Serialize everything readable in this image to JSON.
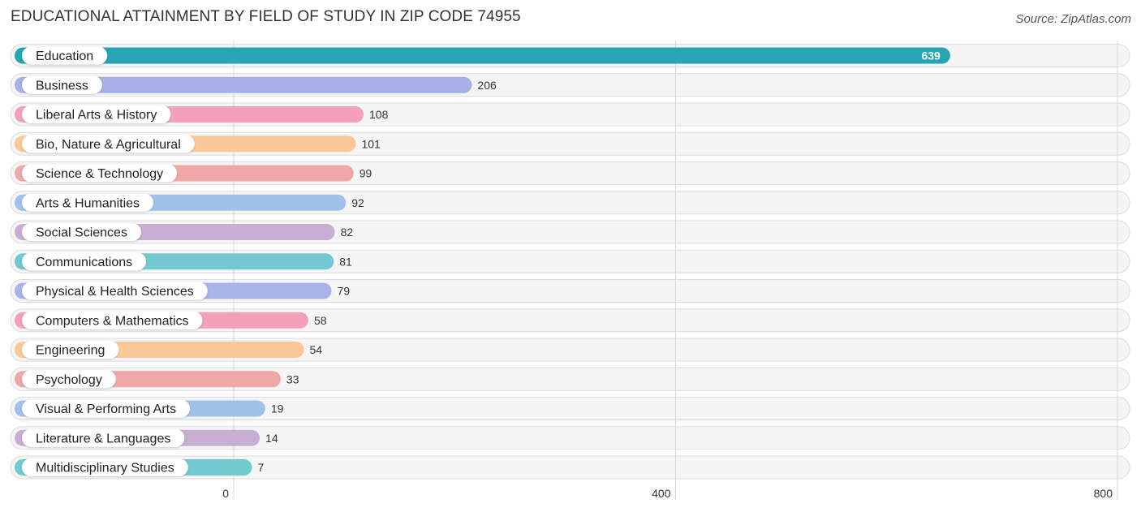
{
  "header": {
    "title": "EDUCATIONAL ATTAINMENT BY FIELD OF STUDY IN ZIP CODE 74955",
    "source": "Source: ZipAtlas.com"
  },
  "chart_data": {
    "type": "bar",
    "orientation": "horizontal",
    "title": "EDUCATIONAL ATTAINMENT BY FIELD OF STUDY IN ZIP CODE 74955",
    "xlabel": "",
    "ylabel": "",
    "xlim": [
      0,
      800
    ],
    "ticks": [
      0,
      400,
      800
    ],
    "tick_labels": [
      "0",
      "400",
      "800"
    ],
    "grid": true,
    "categories": [
      "Education",
      "Business",
      "Liberal Arts & History",
      "Bio, Nature & Agricultural",
      "Science & Technology",
      "Arts & Humanities",
      "Social Sciences",
      "Communications",
      "Physical & Health Sciences",
      "Computers & Mathematics",
      "Engineering",
      "Psychology",
      "Visual & Performing Arts",
      "Literature & Languages",
      "Multidisciplinary Studies"
    ],
    "values": [
      639,
      206,
      108,
      101,
      99,
      92,
      82,
      81,
      79,
      58,
      54,
      33,
      19,
      14,
      7
    ],
    "value_labels": [
      "639",
      "206",
      "108",
      "101",
      "99",
      "92",
      "82",
      "81",
      "79",
      "58",
      "54",
      "33",
      "19",
      "14",
      "7"
    ],
    "colors": [
      "#26a5b5",
      "#a8aee6",
      "#f5a0bb",
      "#f9c898",
      "#eea8a8",
      "#9fc1ea",
      "#c8aed3",
      "#72c8cf",
      "#aab3e7",
      "#f5a0bb",
      "#f9c898",
      "#eea8a8",
      "#9fc1ea",
      "#c8aed3",
      "#72c8cf"
    ]
  }
}
